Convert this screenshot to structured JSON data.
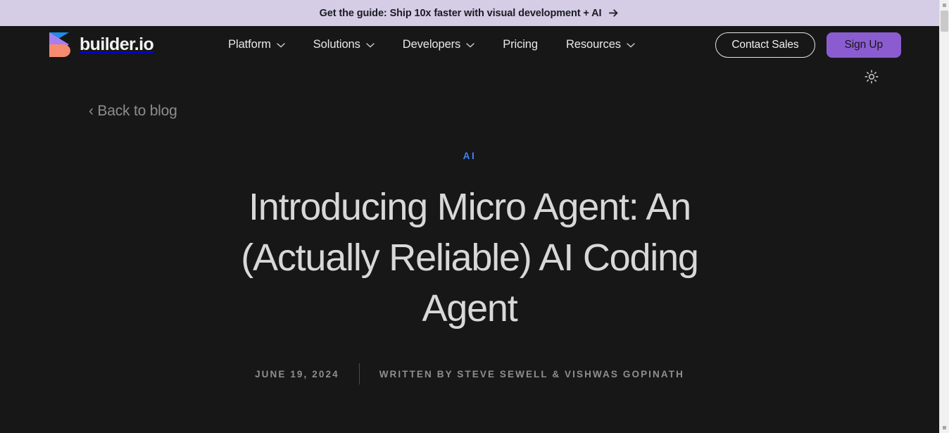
{
  "promo": {
    "text": "Get the guide: Ship 10x faster with visual development + AI",
    "arrow_icon": "arrow-right-icon",
    "background_color": "#d5cce5",
    "text_color": "#1b1b22"
  },
  "header": {
    "brand": {
      "name": "builder.io",
      "logo_icon": "builder-io-logo-icon",
      "colors": {
        "blue": "#1f8ce8",
        "purple": "#a87ff0",
        "salmon": "#f68b6f"
      }
    },
    "nav": [
      {
        "label": "Platform",
        "has_dropdown": true,
        "icon": "chevron-down-icon"
      },
      {
        "label": "Solutions",
        "has_dropdown": true,
        "icon": "chevron-down-icon"
      },
      {
        "label": "Developers",
        "has_dropdown": true,
        "icon": "chevron-down-icon"
      },
      {
        "label": "Pricing",
        "has_dropdown": false,
        "icon": ""
      },
      {
        "label": "Resources",
        "has_dropdown": true,
        "icon": "chevron-down-icon"
      }
    ],
    "contact_sales_label": "Contact Sales",
    "sign_up_label": "Sign Up",
    "sign_up_color": "#8b5cd0"
  },
  "utility": {
    "theme_toggle_icon": "sun-icon"
  },
  "article": {
    "back_link": "‹ Back to blog",
    "category": "AI",
    "category_color": "#3d84f7",
    "title": "Introducing Micro Agent: An (Actually Reliable) AI Coding Agent",
    "date": "JUNE 19, 2024",
    "authors": "WRITTEN BY STEVE SEWELL & VISHWAS GOPINATH"
  },
  "scrollbar": {
    "position": "top"
  }
}
